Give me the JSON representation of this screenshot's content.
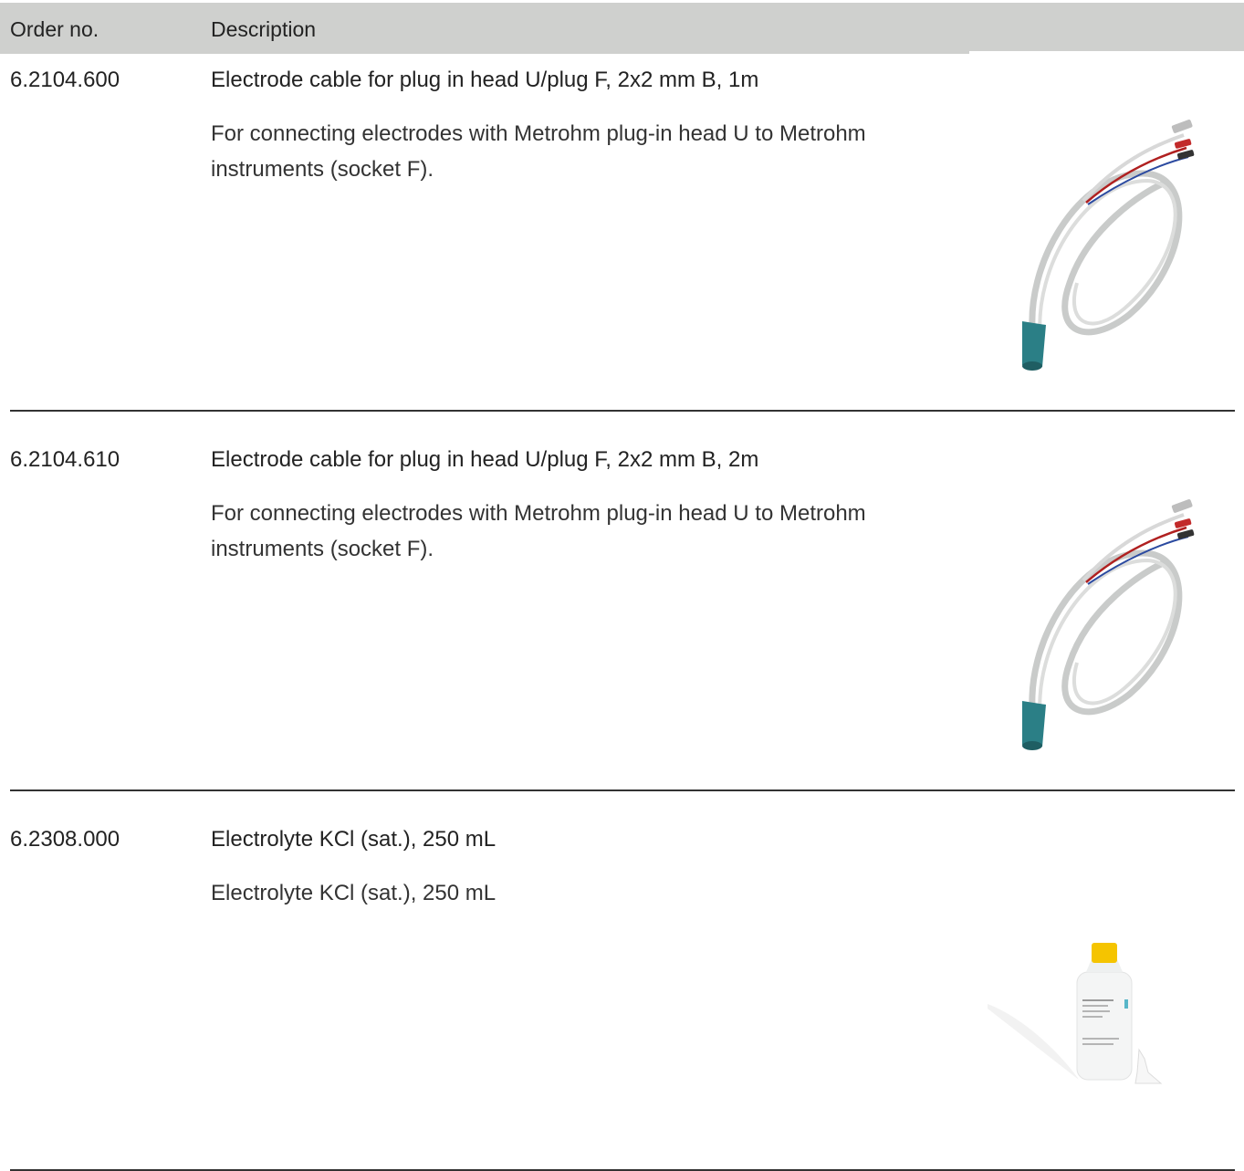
{
  "table": {
    "headers": {
      "order": "Order no.",
      "description": "Description"
    },
    "rows": [
      {
        "order_no": "6.2104.600",
        "title": "Electrode cable for plug in head U/plug F, 2x2 mm B, 1m",
        "description": "For connecting electrodes with Metrohm plug-in head U to Metrohm instruments (socket F).",
        "image": "electrode-cable-image"
      },
      {
        "order_no": "6.2104.610",
        "title": "Electrode cable for plug in head U/plug F, 2x2 mm B, 2m",
        "description": "For connecting electrodes with Metrohm plug-in head U to Metrohm instruments (socket F).",
        "image": "electrode-cable-image"
      },
      {
        "order_no": "6.2308.000",
        "title": "Electrolyte KCl (sat.), 250 mL",
        "description": "Electrolyte KCl (sat.), 250 mL",
        "image": "electrolyte-bottle-image"
      }
    ]
  },
  "colors": {
    "header_bg": "#cfd0ce",
    "divider": "#333333",
    "cable_head": "#2b7f86",
    "bottle_cap": "#f5c400"
  }
}
